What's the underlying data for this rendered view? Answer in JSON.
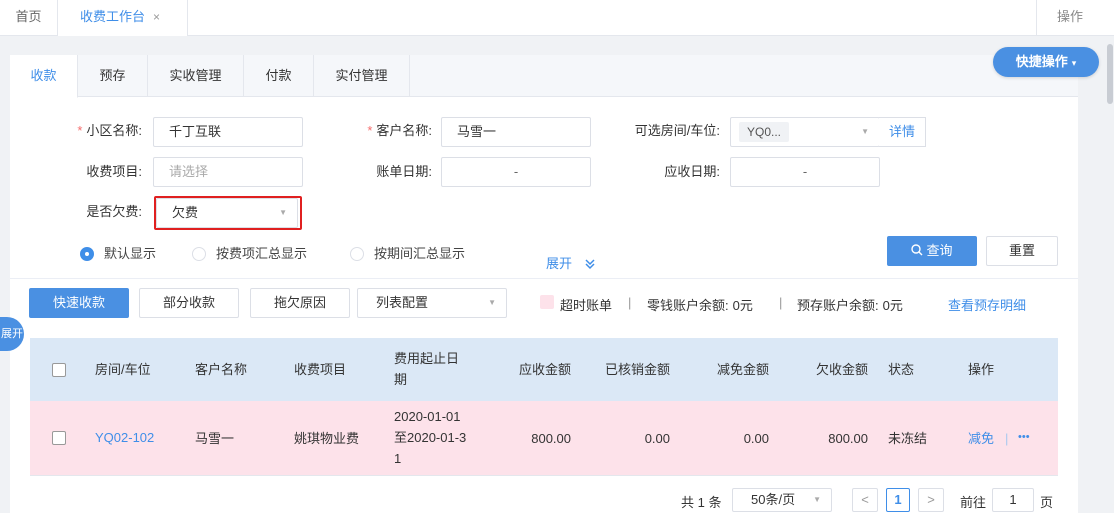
{
  "topbar": {
    "home": "首页",
    "active_tab": "收费工作台",
    "close": "×",
    "ops": "操作"
  },
  "quick_action": {
    "label": "快捷操作",
    "caret": "▾"
  },
  "tabs": [
    {
      "label": "收款",
      "active": true
    },
    {
      "label": "预存"
    },
    {
      "label": "实收管理"
    },
    {
      "label": "付款"
    },
    {
      "label": "实付管理"
    }
  ],
  "form": {
    "community": {
      "label": "小区名称:",
      "value": "千丁互联",
      "required": "*"
    },
    "customer": {
      "label": "客户名称:",
      "value": "马雪一",
      "required": "*"
    },
    "room": {
      "label": "可选房间/车位:",
      "value": "YQ0...",
      "detail": "详情"
    },
    "charge_item": {
      "label": "收费项目:",
      "placeholder": "请选择"
    },
    "bill_date": {
      "label": "账单日期:",
      "value": "-"
    },
    "due_date": {
      "label": "应收日期:",
      "value": "-"
    },
    "arrears": {
      "label": "是否欠费:",
      "value": "欠费"
    }
  },
  "display_modes": [
    {
      "label": "默认显示",
      "checked": true
    },
    {
      "label": "按费项汇总显示"
    },
    {
      "label": "按期间汇总显示"
    }
  ],
  "expand": {
    "label": "展开",
    "icon": "double-chevron-down"
  },
  "buttons": {
    "query": "查询",
    "reset": "重置"
  },
  "toolbar": {
    "fast_collect": "快速收款",
    "partial_collect": "部分收款",
    "arrears_reason": "拖欠原因",
    "list_config": "列表配置",
    "overdue_legend": "超时账单",
    "sep": "|",
    "change_balance": "零钱账户余额:",
    "change_balance_value": "0元",
    "prestore_balance": "预存账户余额:",
    "prestore_balance_value": "0元",
    "view_prestore": "查看预存明细"
  },
  "side_tag": "展开",
  "table": {
    "headers": [
      "房间/车位",
      "客户名称",
      "收费项目",
      "费用起止日期",
      "应收金额",
      "已核销金额",
      "减免金额",
      "欠收金额",
      "状态",
      "操作"
    ],
    "header_period_lines": [
      "费用起止日",
      "期"
    ],
    "rows": [
      {
        "room": "YQ02-102",
        "customer": "马雪一",
        "item": "姚琪物业费",
        "period_lines": [
          "2020-01-01",
          "至2020-01-3",
          "1"
        ],
        "receivable": "800.00",
        "written_off": "0.00",
        "reduction": "0.00",
        "owed": "800.00",
        "status": "未冻结",
        "action": "减免",
        "action_sep": "|",
        "more": "•••"
      }
    ]
  },
  "pagination": {
    "total": "共 1 条",
    "page_size": "50条/页",
    "prev": "<",
    "current": "1",
    "next": ">",
    "goto": "前往",
    "goto_value": "1",
    "page_unit": "页"
  },
  "colors": {
    "accent": "#4a90e2",
    "link": "#3f8ee8",
    "overdue_row": "#fde2ea",
    "header_bg": "#dbe8f6",
    "required": "#f56c6c",
    "highlight": "#e02020"
  }
}
